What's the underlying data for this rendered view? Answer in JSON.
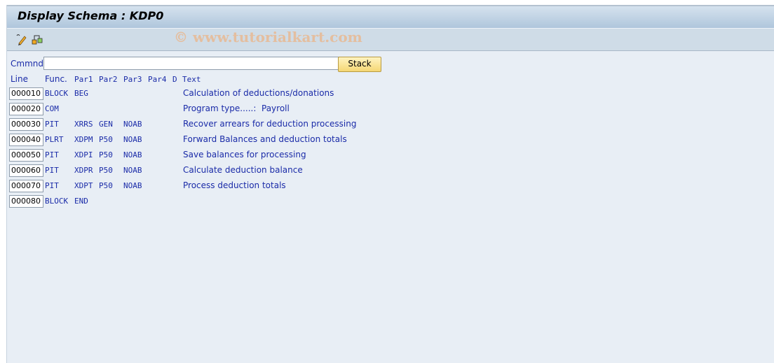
{
  "window": {
    "title": "Display Schema : KDP0"
  },
  "toolbar": {
    "icons": [
      {
        "name": "display-change-icon"
      },
      {
        "name": "hierarchy-icon"
      }
    ],
    "watermark": "© www.tutorialkart.com"
  },
  "command": {
    "label": "Cmmnd",
    "value": "",
    "stack_label": "Stack"
  },
  "columns": {
    "line": "Line",
    "func": "Func.",
    "par1": "Par1",
    "par2": "Par2",
    "par3": "Par3",
    "par4": "Par4",
    "d": "D",
    "text": "Text"
  },
  "rows": [
    {
      "line": "000010",
      "func": "BLOCK",
      "par1": "BEG",
      "par2": "",
      "par3": "",
      "par4": "",
      "d": "",
      "text": "Calculation of deductions/donations"
    },
    {
      "line": "000020",
      "func": "COM",
      "par1": "",
      "par2": "",
      "par3": "",
      "par4": "",
      "d": "",
      "text": "Program type.....:  Payroll"
    },
    {
      "line": "000030",
      "func": "PIT",
      "par1": "XRRS",
      "par2": "GEN",
      "par3": "NOAB",
      "par4": "",
      "d": "",
      "text": "Recover arrears for deduction processing"
    },
    {
      "line": "000040",
      "func": "PLRT",
      "par1": "XDPM",
      "par2": "P50",
      "par3": "NOAB",
      "par4": "",
      "d": "",
      "text": "Forward Balances and deduction totals"
    },
    {
      "line": "000050",
      "func": "PIT",
      "par1": "XDPI",
      "par2": "P50",
      "par3": "NOAB",
      "par4": "",
      "d": "",
      "text": "Save balances for processing"
    },
    {
      "line": "000060",
      "func": "PIT",
      "par1": "XDPR",
      "par2": "P50",
      "par3": "NOAB",
      "par4": "",
      "d": "",
      "text": "Calculate deduction balance"
    },
    {
      "line": "000070",
      "func": "PIT",
      "par1": "XDPT",
      "par2": "P50",
      "par3": "NOAB",
      "par4": "",
      "d": "",
      "text": "Process deduction totals"
    },
    {
      "line": "000080",
      "func": "BLOCK",
      "par1": "END",
      "par2": "",
      "par3": "",
      "par4": "",
      "d": "",
      "text": ""
    }
  ]
}
